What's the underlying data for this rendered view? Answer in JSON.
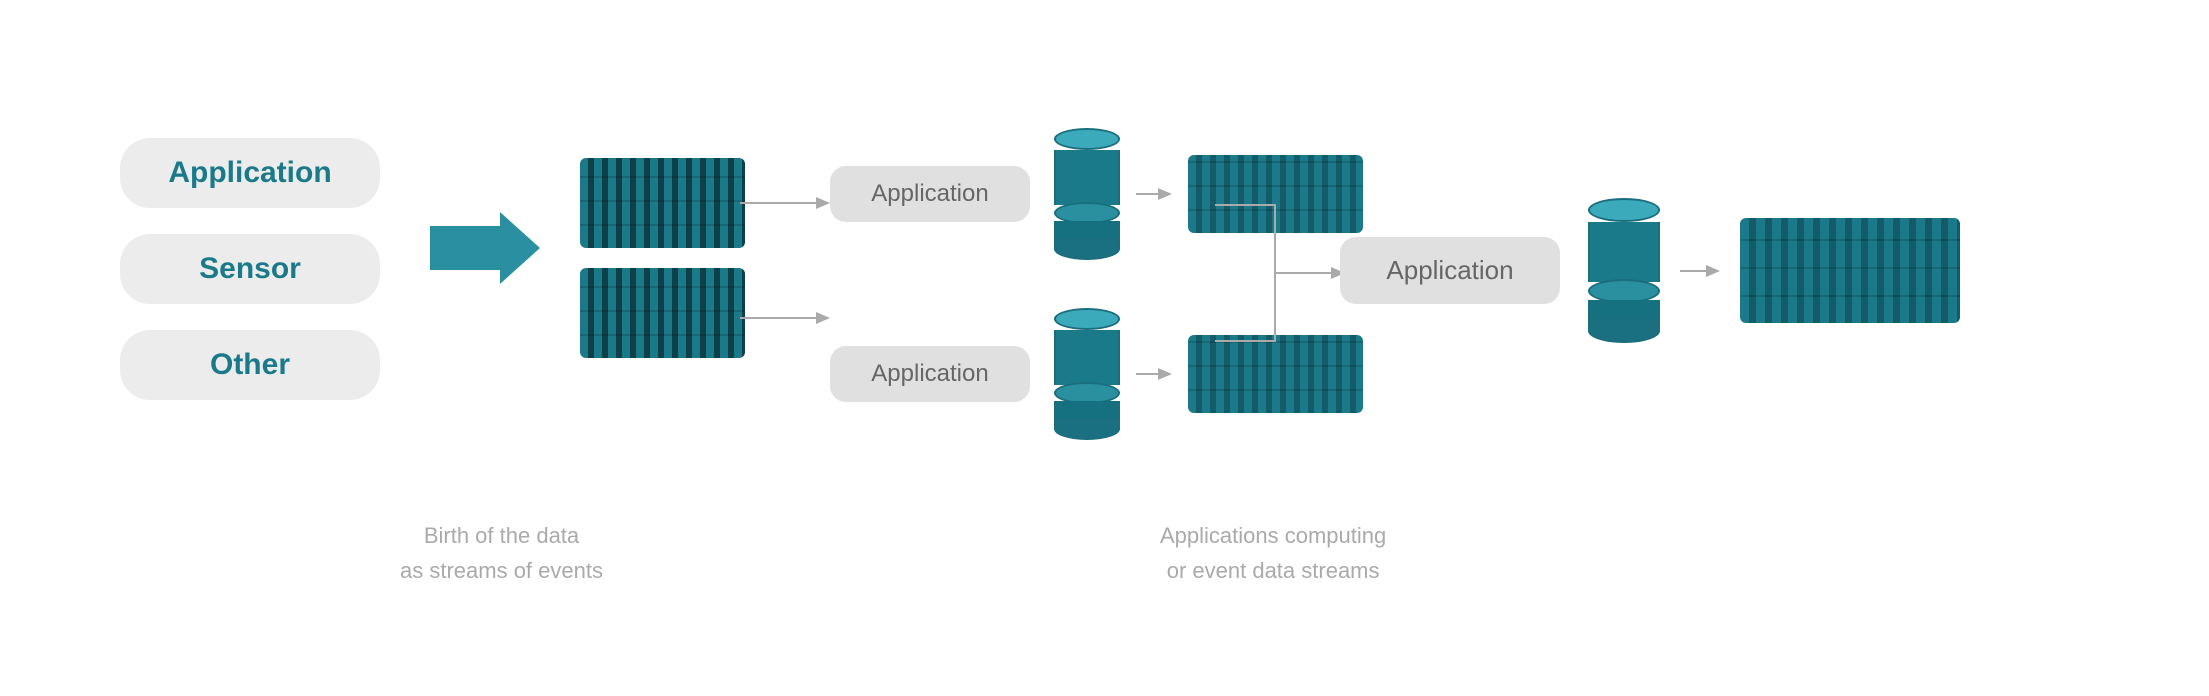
{
  "sources": [
    {
      "label": "Application"
    },
    {
      "label": "Sensor"
    },
    {
      "label": "Other"
    }
  ],
  "middle": {
    "app_label_1": "Application",
    "app_label_2": "Application",
    "app_label_right": "Application"
  },
  "labels": {
    "left": "Birth of the data\nas streams of events",
    "right": "Applications computing\nor event data streams"
  },
  "colors": {
    "teal": "#1a7a8a",
    "light_teal": "#3baabb",
    "arrow": "#2a8fa0",
    "pill_bg": "#ececec",
    "app_box_bg": "#e0e0e0",
    "text_dark": "#1a7a8a",
    "text_gray": "#999999"
  }
}
